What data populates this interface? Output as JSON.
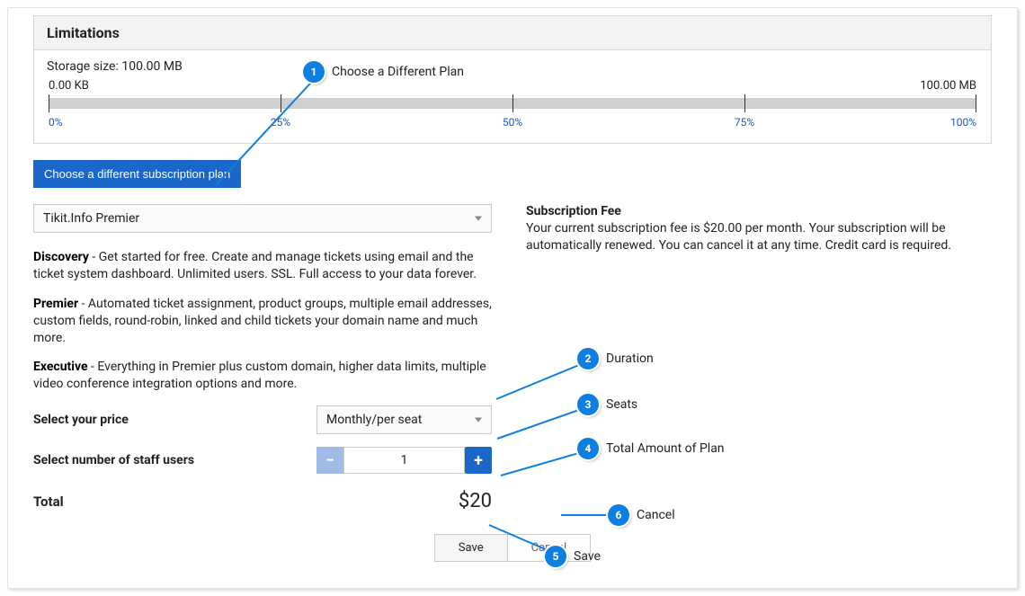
{
  "limitations": {
    "title": "Limitations",
    "storage_label": "Storage size: 100.00 MB",
    "used_label": "0.00 KB",
    "max_label": "100.00 MB",
    "scale": {
      "p0": "0%",
      "p25": "25%",
      "p50": "50%",
      "p75": "75%",
      "p100": "100%"
    }
  },
  "choose_plan_btn": "Choose a different subscription plan",
  "plan_select": {
    "value": "Tikit.Info Premier"
  },
  "descriptions": {
    "discovery": {
      "name": "Discovery",
      "text": " - Get started for free. Create and manage tickets using email and the ticket system dashboard. Unlimited users. SSL. Full access to your data forever."
    },
    "premier": {
      "name": "Premier",
      "text": " - Automated ticket assignment, product groups, multiple email addresses, custom fields, round-robin, linked and child tickets your domain name and much more."
    },
    "executive": {
      "name": "Executive",
      "text": " - Everything in Premier plus custom domain, higher data limits, multiple video conference integration options and more."
    }
  },
  "price": {
    "label": "Select your price",
    "value": "Monthly/per seat"
  },
  "seats": {
    "label": "Select number of staff users",
    "value": "1"
  },
  "total": {
    "label": "Total",
    "value": "$20"
  },
  "actions": {
    "save": "Save",
    "cancel": "Cancel"
  },
  "fee": {
    "heading": "Subscription Fee",
    "text": "Your current subscription fee is $20.00 per month. Your subscription will be automatically renewed. You can cancel it at any time. Credit card is required."
  },
  "callouts": {
    "c1": {
      "n": "1",
      "text": "Choose a Different Plan"
    },
    "c2": {
      "n": "2",
      "text": "Duration"
    },
    "c3": {
      "n": "3",
      "text": "Seats"
    },
    "c4": {
      "n": "4",
      "text": "Total Amount of Plan"
    },
    "c5": {
      "n": "5",
      "text": "Save"
    },
    "c6": {
      "n": "6",
      "text": "Cancel"
    }
  }
}
